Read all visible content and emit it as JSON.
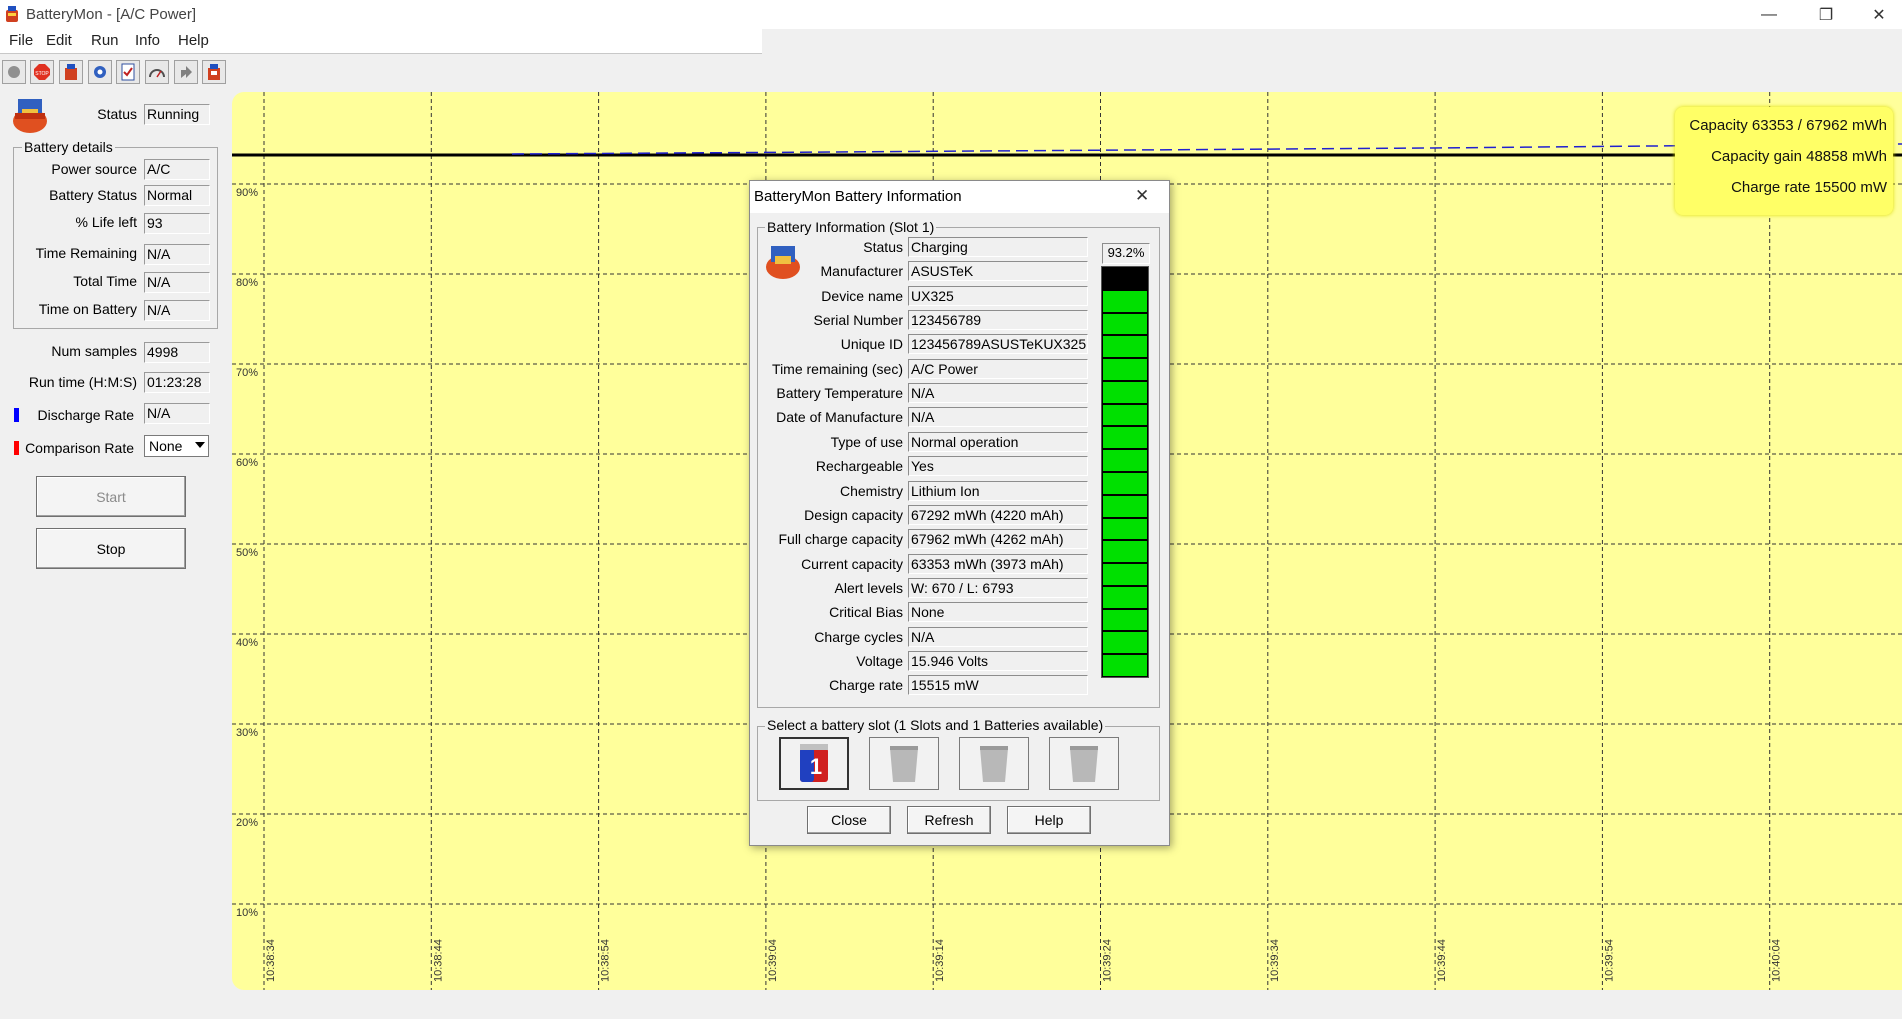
{
  "window": {
    "title": "BatteryMon - [A/C Power]",
    "min_glyph": "—",
    "max_glyph": "❐",
    "close_glyph": "✕"
  },
  "menu": [
    "File",
    "Edit",
    "Run",
    "Info",
    "Help"
  ],
  "toolbar": [
    "record-icon",
    "stop-icon",
    "battery-icon",
    "settings-icon",
    "checklist-icon",
    "gauge-icon",
    "export-icon",
    "battery-info-icon"
  ],
  "left_panel": {
    "status_label": "Status",
    "status_value": "Running",
    "battery_details_title": "Battery details",
    "details": [
      {
        "label": "Power source",
        "value": "A/C"
      },
      {
        "label": "Battery Status",
        "value": "Normal"
      },
      {
        "label": "% Life left",
        "value": "93"
      },
      {
        "label": "Time Remaining",
        "value": "N/A"
      },
      {
        "label": "Total Time",
        "value": "N/A"
      },
      {
        "label": "Time on Battery",
        "value": "N/A"
      }
    ],
    "num_samples_label": "Num samples",
    "num_samples_value": "4998",
    "run_time_label": "Run time (H:M:S)",
    "run_time_value": "01:23:28",
    "discharge_label": "Discharge Rate",
    "discharge_value": "N/A",
    "discharge_color": "#0000ff",
    "comparison_label": "Comparison Rate",
    "comparison_value": "None",
    "comparison_color": "#ff0000",
    "start_label": "Start",
    "stop_label": "Stop"
  },
  "chart": {
    "background": "#ffff9b",
    "y_ticks": [
      "90%",
      "80%",
      "70%",
      "60%",
      "50%",
      "40%",
      "30%",
      "20%",
      "10%"
    ],
    "x_ticks": [
      "10:38:34",
      "10:38:44",
      "10:38:54",
      "10:39:04",
      "10:39:14",
      "10:39:24",
      "10:39:34",
      "10:39:44",
      "10:39:54",
      "10:40:04"
    ],
    "legend": {
      "capacity": "Capacity 63353 / 67962 mWh",
      "gain": "Capacity gain 48858 mWh",
      "rate": "Charge rate 15500 mW"
    }
  },
  "dialog": {
    "title": "BatteryMon Battery Information",
    "close_glyph": "✕",
    "info_group": "Battery Information (Slot 1)",
    "percent": "93.2%",
    "level_fraction": 0.932,
    "rows": [
      {
        "label": "Status",
        "value": "Charging"
      },
      {
        "label": "Manufacturer",
        "value": "ASUSTeK"
      },
      {
        "label": "Device name",
        "value": "UX325"
      },
      {
        "label": "Serial Number",
        "value": "123456789"
      },
      {
        "label": "Unique ID",
        "value": "123456789ASUSTeKUX325"
      },
      {
        "label": "Time remaining (sec)",
        "value": "A/C Power"
      },
      {
        "label": "Battery Temperature",
        "value": "N/A"
      },
      {
        "label": "Date of Manufacture",
        "value": "N/A"
      },
      {
        "label": "Type of use",
        "value": "Normal operation"
      },
      {
        "label": "Rechargeable",
        "value": "Yes"
      },
      {
        "label": "Chemistry",
        "value": "Lithium Ion"
      },
      {
        "label": "Design capacity",
        "value": "67292 mWh (4220 mAh)"
      },
      {
        "label": "Full charge capacity",
        "value": "67962 mWh (4262 mAh)"
      },
      {
        "label": "Current capacity",
        "value": "63353 mWh (3973 mAh)"
      },
      {
        "label": "Alert levels",
        "value": "W: 670 / L: 6793"
      },
      {
        "label": "Critical Bias",
        "value": "None"
      },
      {
        "label": "Charge cycles",
        "value": "N/A"
      },
      {
        "label": "Voltage",
        "value": "15.946 Volts"
      },
      {
        "label": "Charge rate",
        "value": "15515 mW"
      }
    ],
    "slot_group": "Select a battery slot (1 Slots and 1 Batteries available)",
    "close_label": "Close",
    "refresh_label": "Refresh",
    "help_label": "Help"
  }
}
